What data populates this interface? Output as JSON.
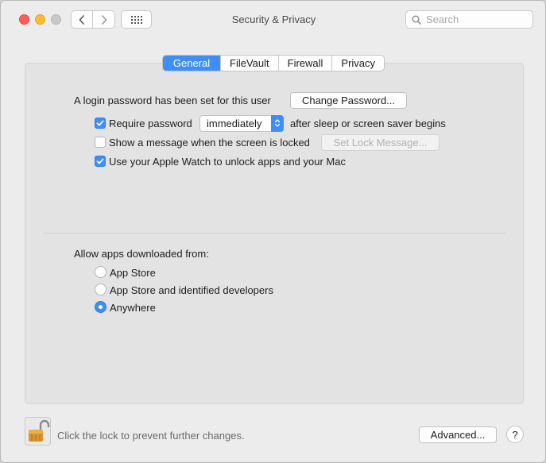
{
  "window": {
    "title": "Security & Privacy"
  },
  "search": {
    "placeholder": "Search"
  },
  "tabs": [
    {
      "label": "General",
      "active": true
    },
    {
      "label": "FileVault",
      "active": false
    },
    {
      "label": "Firewall",
      "active": false
    },
    {
      "label": "Privacy",
      "active": false
    }
  ],
  "general": {
    "login_text": "A login password has been set for this user",
    "change_password_label": "Change Password...",
    "require_password": {
      "checked": true,
      "label": "Require password",
      "selected_value": "immediately",
      "suffix": "after sleep or screen saver begins"
    },
    "show_message": {
      "checked": false,
      "label": "Show a message when the screen is locked",
      "button_label": "Set Lock Message..."
    },
    "apple_watch": {
      "checked": true,
      "label": "Use your Apple Watch to unlock apps and your Mac"
    },
    "allow_apps": {
      "heading": "Allow apps downloaded from:",
      "options": [
        {
          "label": "App Store",
          "selected": false
        },
        {
          "label": "App Store and identified developers",
          "selected": false
        },
        {
          "label": "Anywhere",
          "selected": true
        }
      ]
    }
  },
  "footer": {
    "lock_text": "Click the lock to prevent further changes.",
    "advanced_label": "Advanced...",
    "help_label": "?"
  },
  "colors": {
    "accent": "#3f8ef7",
    "close": "#ff5f57",
    "minimize": "#febc2e",
    "zoom": "#c8c8c8"
  }
}
